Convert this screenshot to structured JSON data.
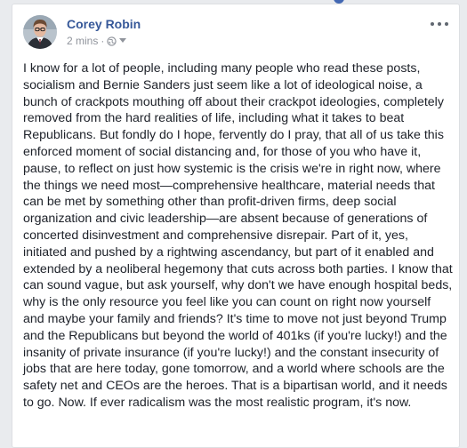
{
  "post": {
    "author_name": "Corey Robin",
    "timestamp": "2 mins",
    "separator": "·",
    "audience_icon": "globe-icon",
    "audience_dropdown_icon": "caret-down-icon",
    "options_icon": "more-options-icon",
    "body": "I know for a lot of people, including many people who read these posts, socialism and Bernie Sanders just seem like a lot of ideological noise, a bunch of crackpots mouthing off about their crackpot ideologies, completely removed from the hard realities of life, including what it takes to beat Republicans. But fondly do I hope, fervently do I pray, that all of us take this enforced moment of social distancing and, for those of you who have it, pause, to reflect on just how systemic is the crisis we're in right now, where the things we need most—comprehensive healthcare, material needs that can be met by something other than profit-driven firms, deep social organization and civic leadership—are absent because of generations of concerted disinvestment and comprehensive disrepair. Part of it, yes, initiated and pushed by a rightwing ascendancy, but part of it enabled and extended by a neoliberal hegemony that cuts across both parties. I know that can sound vague, but ask yourself, why don't we have enough hospital beds, why is the only resource you feel like you can count on right now yourself and maybe your family and friends? It's time to move not just beyond Trump and the Republicans but beyond the world of 401ks (if you're lucky!) and the insanity of private insurance (if you're lucky!) and the constant insecurity of jobs that are here today, gone tomorrow, and a world where schools are the safety net and CEOs are the heroes. That is a bipartisan world, and it needs to go. Now. If ever radicalism was the most realistic program, it's now."
  },
  "colors": {
    "author_link": "#365899",
    "meta_text": "#90949c",
    "body_text": "#1d2129",
    "page_background": "#e9ebee"
  }
}
